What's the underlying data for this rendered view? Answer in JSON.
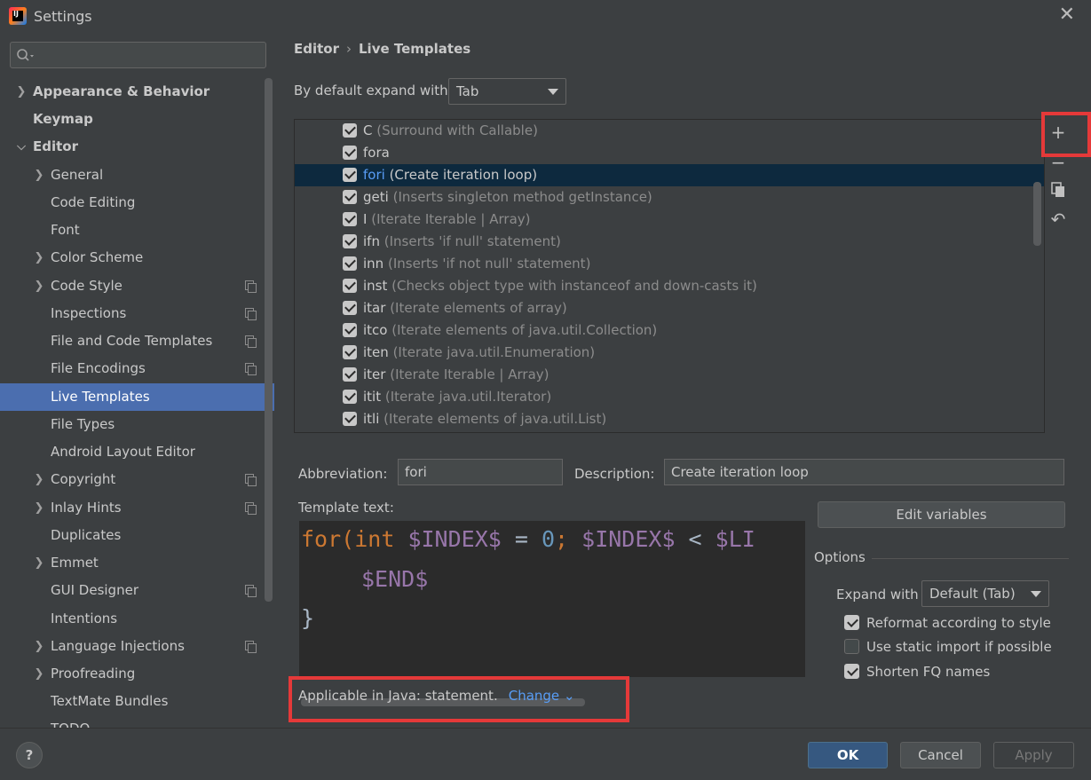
{
  "window": {
    "title": "Settings"
  },
  "sidebar": {
    "search": {
      "placeholder": ""
    },
    "items": [
      {
        "label": "Appearance & Behavior"
      },
      {
        "label": "Keymap"
      },
      {
        "label": "Editor"
      },
      {
        "label": "General"
      },
      {
        "label": "Code Editing"
      },
      {
        "label": "Font"
      },
      {
        "label": "Color Scheme"
      },
      {
        "label": "Code Style"
      },
      {
        "label": "Inspections"
      },
      {
        "label": "File and Code Templates"
      },
      {
        "label": "File Encodings"
      },
      {
        "label": "Live Templates"
      },
      {
        "label": "File Types"
      },
      {
        "label": "Android Layout Editor"
      },
      {
        "label": "Copyright"
      },
      {
        "label": "Inlay Hints"
      },
      {
        "label": "Duplicates"
      },
      {
        "label": "Emmet"
      },
      {
        "label": "GUI Designer"
      },
      {
        "label": "Intentions"
      },
      {
        "label": "Language Injections"
      },
      {
        "label": "Proofreading"
      },
      {
        "label": "TextMate Bundles"
      },
      {
        "label": "TODO"
      }
    ]
  },
  "main": {
    "breadcrumb": {
      "parent": "Editor",
      "separator": "›",
      "current": "Live Templates"
    },
    "expand_default": {
      "label": "By default expand with",
      "value": "Tab"
    },
    "templates": [
      {
        "abbr": "C",
        "desc": "(Surround with Callable)",
        "checked": true
      },
      {
        "abbr": "fora",
        "desc": "",
        "checked": true
      },
      {
        "abbr": "fori",
        "desc": "(Create iteration loop)",
        "checked": true,
        "selected": true
      },
      {
        "abbr": "geti",
        "desc": "(Inserts singleton method getInstance)",
        "checked": true
      },
      {
        "abbr": "I",
        "desc": "(Iterate Iterable | Array)",
        "checked": true
      },
      {
        "abbr": "ifn",
        "desc": "(Inserts 'if null' statement)",
        "checked": true
      },
      {
        "abbr": "inn",
        "desc": "(Inserts 'if not null' statement)",
        "checked": true
      },
      {
        "abbr": "inst",
        "desc": "(Checks object type with instanceof and down-casts it)",
        "checked": true
      },
      {
        "abbr": "itar",
        "desc": "(Iterate elements of array)",
        "checked": true
      },
      {
        "abbr": "itco",
        "desc": "(Iterate elements of java.util.Collection)",
        "checked": true
      },
      {
        "abbr": "iten",
        "desc": "(Iterate java.util.Enumeration)",
        "checked": true
      },
      {
        "abbr": "iter",
        "desc": "(Iterate Iterable | Array)",
        "checked": true
      },
      {
        "abbr": "itit",
        "desc": "(Iterate java.util.Iterator)",
        "checked": true
      },
      {
        "abbr": "itli",
        "desc": "(Iterate elements of java.util.List)",
        "checked": true
      }
    ],
    "toolbar": {
      "add": "+",
      "remove": "−",
      "undo": "↶"
    },
    "abbreviation": {
      "label": "Abbreviation:",
      "value": "fori"
    },
    "description": {
      "label": "Description:",
      "value": "Create iteration loop"
    },
    "template_text": {
      "label": "Template text:",
      "line1": {
        "kw1": "for(",
        "kw2": "int",
        "var1": "$INDEX$",
        "op1": " = ",
        "num": "0",
        "semi": ";",
        "var2": "$INDEX$",
        "op2": " < ",
        "var3": "$LI"
      },
      "line2": "$END$",
      "line3": "}"
    },
    "edit_variables": "Edit variables",
    "options": {
      "title": "Options",
      "expand_with": {
        "label": "Expand with",
        "value": "Default (Tab)"
      },
      "checkboxes": [
        {
          "label": "Reformat according to style",
          "checked": true
        },
        {
          "label": "Use static import if possible",
          "checked": false
        },
        {
          "label": "Shorten FQ names",
          "checked": true
        }
      ]
    },
    "applicable": {
      "text": "Applicable in Java: statement.",
      "link": "Change"
    }
  },
  "footer": {
    "help": "?",
    "ok": "OK",
    "cancel": "Cancel",
    "apply": "Apply"
  },
  "colors": {
    "accent": "#4b6eaf",
    "highlight_box": "#e53939",
    "link": "#589df6"
  }
}
